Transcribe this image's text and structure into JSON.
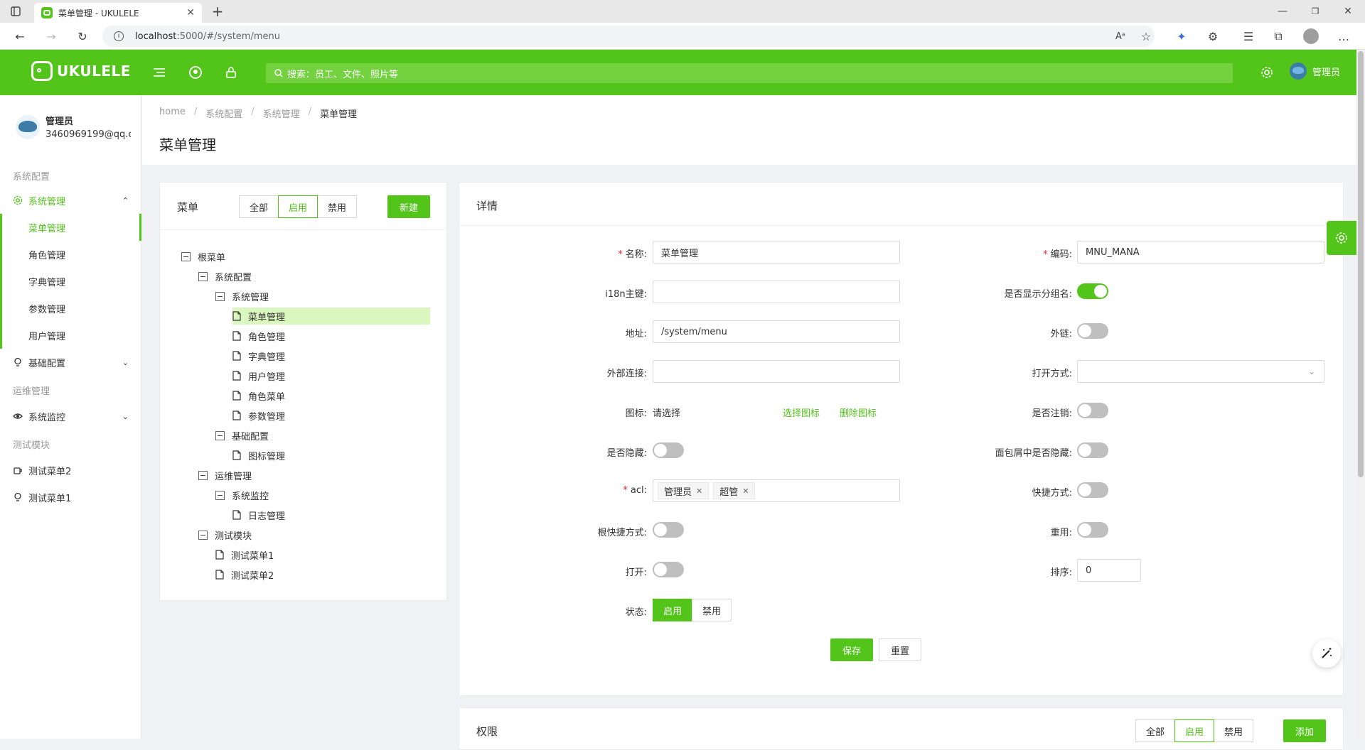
{
  "browser": {
    "tab_title": "菜单管理 - UKULELE",
    "url_host": "localhost",
    "url_rest": ":5000/#/system/menu"
  },
  "header": {
    "logo_text": "UKULELE",
    "search_placeholder": "搜索：员工、文件、照片等",
    "username": "管理员",
    "accent_color": "#52c41a"
  },
  "user": {
    "name": "管理员",
    "email": "3460969199@qq.c"
  },
  "sidebar": {
    "group_system": "系统配置",
    "item_system_mgmt": "系统管理",
    "sub_items": [
      "菜单管理",
      "角色管理",
      "字典管理",
      "参数管理",
      "用户管理"
    ],
    "item_basic": "基础配置",
    "group_ops": "运维管理",
    "item_monitor": "系统监控",
    "group_test": "测试模块",
    "item_test2": "测试菜单2",
    "item_test1": "测试菜单1"
  },
  "breadcrumb": [
    "home",
    "系统配置",
    "系统管理",
    "菜单管理"
  ],
  "page_title": "菜单管理",
  "menu_panel": {
    "title": "菜单",
    "filters": [
      "全部",
      "启用",
      "禁用"
    ],
    "active_filter": "启用",
    "new_button": "新建",
    "tree": [
      {
        "label": "根菜单",
        "level": 0,
        "type": "folder"
      },
      {
        "label": "系统配置",
        "level": 1,
        "type": "folder"
      },
      {
        "label": "系统管理",
        "level": 2,
        "type": "folder"
      },
      {
        "label": "菜单管理",
        "level": 3,
        "type": "file",
        "selected": true
      },
      {
        "label": "角色管理",
        "level": 3,
        "type": "file"
      },
      {
        "label": "字典管理",
        "level": 3,
        "type": "file"
      },
      {
        "label": "用户管理",
        "level": 3,
        "type": "file"
      },
      {
        "label": "角色菜单",
        "level": 3,
        "type": "file"
      },
      {
        "label": "参数管理",
        "level": 3,
        "type": "file"
      },
      {
        "label": "基础配置",
        "level": 2,
        "type": "folder"
      },
      {
        "label": "图标管理",
        "level": 3,
        "type": "file"
      },
      {
        "label": "运维管理",
        "level": 1,
        "type": "folder"
      },
      {
        "label": "系统监控",
        "level": 2,
        "type": "folder"
      },
      {
        "label": "日志管理",
        "level": 3,
        "type": "file"
      },
      {
        "label": "测试模块",
        "level": 1,
        "type": "folder"
      },
      {
        "label": "测试菜单1",
        "level": 2,
        "type": "file"
      },
      {
        "label": "测试菜单2",
        "level": 2,
        "type": "file"
      }
    ]
  },
  "detail_panel": {
    "title": "详情",
    "name_label": "名称:",
    "name_value": "菜单管理",
    "code_label": "编码:",
    "code_value": "MNU_MANA",
    "i18n_label": "i18n主键:",
    "i18n_value": "",
    "show_group_label": "是否显示分组名:",
    "show_group": true,
    "address_label": "地址:",
    "address_value": "/system/menu",
    "external_label": "外链:",
    "external": false,
    "external_link_label": "外部连接:",
    "external_link_value": "",
    "open_mode_label": "打开方式:",
    "open_mode_value": "",
    "icon_label": "图标:",
    "icon_value": "请选择",
    "choose_icon": "选择图标",
    "delete_icon": "删除图标",
    "logout_label": "是否注销:",
    "logout": false,
    "hidden_label": "是否隐藏:",
    "hidden": false,
    "breadcrumb_hidden_label": "面包屑中是否隐藏:",
    "breadcrumb_hidden": false,
    "acl_label": "acl:",
    "acl_tags": [
      "管理员",
      "超管"
    ],
    "shortcut_label": "快捷方式:",
    "shortcut": false,
    "root_shortcut_label": "根快捷方式:",
    "root_shortcut": false,
    "reuse_label": "重用:",
    "reuse": false,
    "open_label": "打开:",
    "open": false,
    "sort_label": "排序:",
    "sort_value": "0",
    "status_label": "状态:",
    "status_options": [
      "启用",
      "禁用"
    ],
    "status_value": "启用",
    "save_button": "保存",
    "reset_button": "重置"
  },
  "permission_panel": {
    "title": "权限",
    "filters": [
      "全部",
      "启用",
      "禁用"
    ],
    "active_filter": "启用",
    "add_button": "添加"
  }
}
